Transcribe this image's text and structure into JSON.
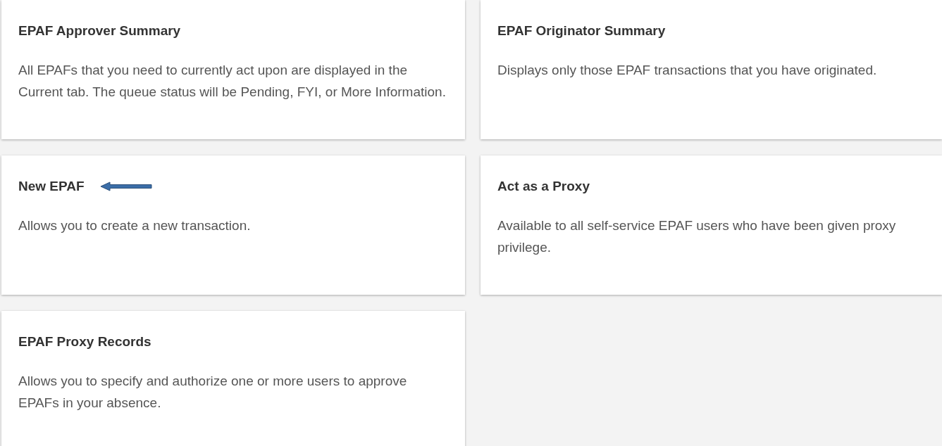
{
  "cards": [
    {
      "title": "EPAF Approver Summary",
      "description": "All EPAFs that you need to currently act upon are displayed in the Current tab. The queue status will be Pending, FYI, or More Information.",
      "marked": false
    },
    {
      "title": "EPAF Originator Summary",
      "description": "Displays only those EPAF transactions that you have originated.",
      "marked": false
    },
    {
      "title": "New EPAF",
      "description": "Allows you to create a new transaction.",
      "marked": true
    },
    {
      "title": "Act as a Proxy",
      "description": "Available to all self-service EPAF users who have been given proxy privilege.",
      "marked": false
    },
    {
      "title": "EPAF Proxy Records",
      "description": "Allows you to specify and authorize one or more users to approve EPAFs in your absence.",
      "marked": false
    }
  ]
}
